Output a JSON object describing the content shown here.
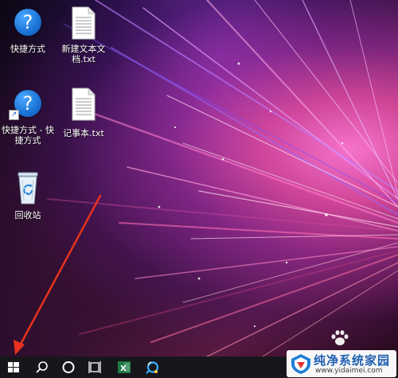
{
  "desktop": {
    "icons": [
      {
        "label": "快捷方式",
        "icon": "help-icon"
      },
      {
        "label": "新建文本文档.txt",
        "line1": "新建文本文",
        "line2": "档.txt",
        "icon": "text-document-icon"
      },
      {
        "label": "快捷方式 - 快捷方式",
        "line1": "快捷方式 - 快",
        "line2": "捷方式",
        "icon": "help-shortcut-icon"
      },
      {
        "label": "记事本.txt",
        "icon": "text-document-icon"
      },
      {
        "label": "回收站",
        "icon": "recycle-bin-icon"
      }
    ]
  },
  "taskbar": {
    "buttons": [
      {
        "name": "start-button",
        "icon": "windows-logo-icon"
      },
      {
        "name": "search-button",
        "icon": "search-icon"
      },
      {
        "name": "cortana-button",
        "icon": "cortana-circle-icon"
      },
      {
        "name": "task-view-button",
        "icon": "task-view-icon"
      },
      {
        "name": "excel-button",
        "icon": "excel-icon"
      },
      {
        "name": "browser-button",
        "icon": "browser-icon"
      }
    ],
    "colors": {
      "background": "#17171b",
      "icon": "#ffffff",
      "excel": "#1d7a43"
    }
  },
  "watermark": {
    "title": "纯净系统家园",
    "url": "www.yidaimei.com",
    "colors": {
      "title": "#1f5fb0",
      "logo_blue": "#1e7fd6",
      "logo_red": "#e2322a"
    }
  },
  "annotation": {
    "color": "#e8321e"
  }
}
